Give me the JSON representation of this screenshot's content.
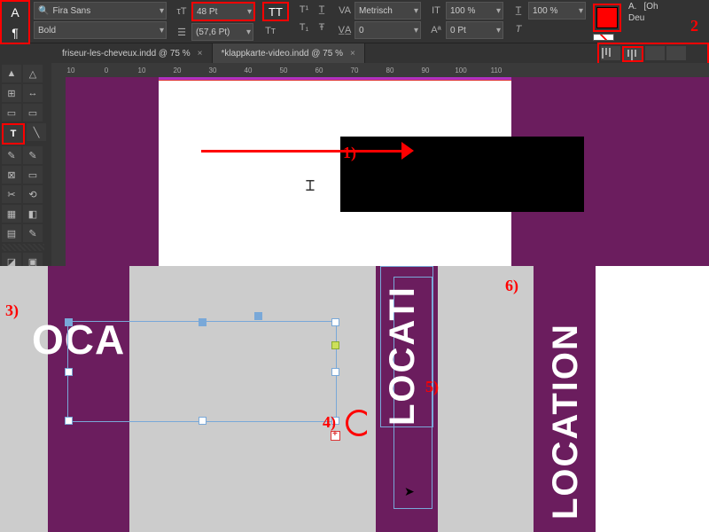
{
  "toolbar": {
    "font_family": "Fira Sans",
    "font_style": "Bold",
    "font_size": "48 Pt",
    "leading": "(57,6 Pt)",
    "caps_btn": "TT",
    "kerning_method": "Metrisch",
    "tracking": "0",
    "scale_x": "100 %",
    "scale_y": "100 %",
    "baseline": "0 Pt",
    "lang": "Deu",
    "good_label": "[Oh",
    "char_a1": "A",
    "char_a2": "¶",
    "fill_label": "A."
  },
  "tabs": [
    {
      "label": "friseur-les-cheveux.indd @ 75 %",
      "active": false
    },
    {
      "label": "*klappkarte-video.indd @ 75 %",
      "active": true
    }
  ],
  "ruler": [
    "10",
    "0",
    "10",
    "20",
    "30",
    "40",
    "50",
    "60",
    "70",
    "80",
    "90",
    "100",
    "110"
  ],
  "annotations": {
    "a1": "1)",
    "a2": "2",
    "a3": "3)",
    "a4": "4)",
    "a5": "5)",
    "a6": "6)"
  },
  "text": {
    "oca": "OCA",
    "locat": "LOCATI",
    "location": "LOCATION"
  },
  "chart_data": null
}
